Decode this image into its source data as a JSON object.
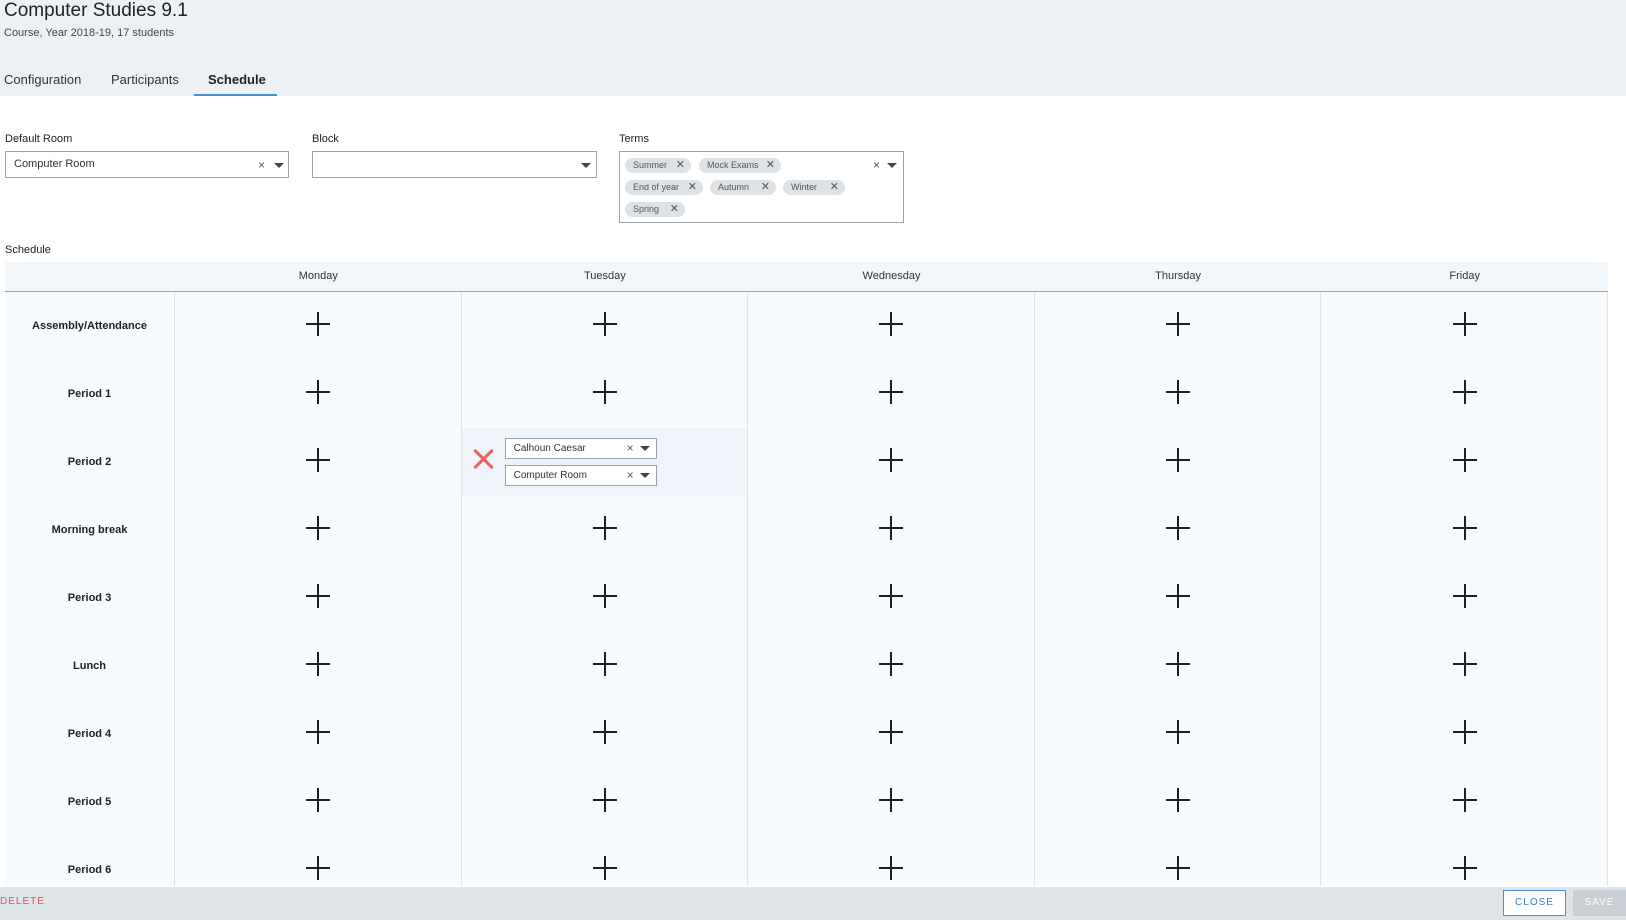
{
  "header": {
    "title": "Computer Studies 9.1",
    "subtitle": "Course, Year 2018-19, 17 students"
  },
  "tabs": [
    {
      "label": "Configuration",
      "active": false
    },
    {
      "label": "Participants",
      "active": false
    },
    {
      "label": "Schedule",
      "active": true
    }
  ],
  "form": {
    "default_room": {
      "label": "Default Room",
      "value": "Computer Room",
      "clear": "×"
    },
    "block": {
      "label": "Block",
      "value": ""
    },
    "terms": {
      "label": "Terms",
      "clear": "×",
      "chips": [
        "Summer",
        "Mock Exams",
        "End of year",
        "Autumn",
        "Winter",
        "Spring"
      ],
      "chip_remove": "✕"
    }
  },
  "schedule": {
    "label": "Schedule",
    "days": [
      "Monday",
      "Tuesday",
      "Wednesday",
      "Thursday",
      "Friday"
    ],
    "periods": [
      "Assembly/Attendance",
      "Period 1",
      "Period 2",
      "Morning break",
      "Period 3",
      "Lunch",
      "Period 4",
      "Period 5",
      "Period 6"
    ],
    "assigned": {
      "period": "Period 2",
      "day": "Tuesday",
      "teacher": "Calhoun Caesar",
      "room": "Computer Room",
      "clear": "×"
    }
  },
  "footer": {
    "delete_label": "DELETE",
    "close_label": "CLOSE",
    "save_label": "SAVE"
  },
  "colors": {
    "accent": "#4a8fd4",
    "danger": "#e8615a",
    "header_bg": "#eef1f4"
  }
}
